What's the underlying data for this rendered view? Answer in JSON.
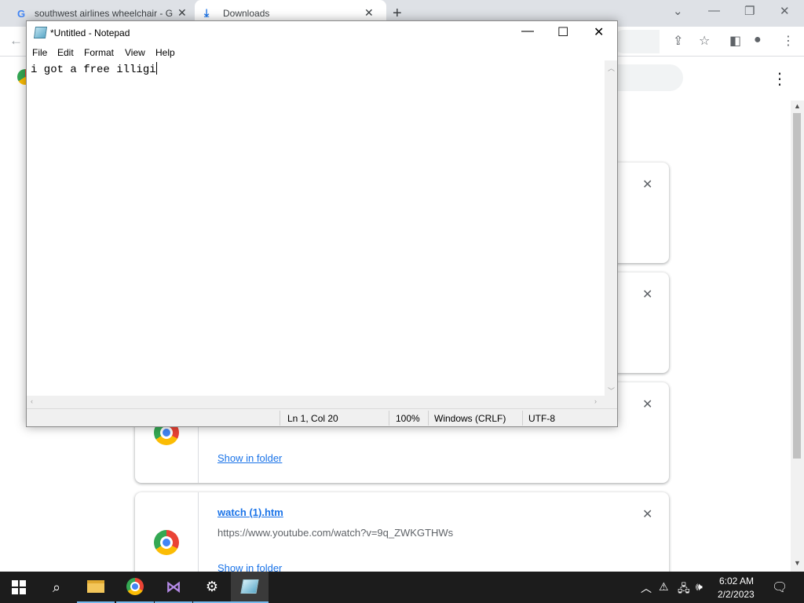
{
  "browser": {
    "tabs": [
      {
        "title": "southwest airlines wheelchair - G",
        "icon": "google-icon"
      },
      {
        "title": "Downloads",
        "icon": "download-icon"
      }
    ],
    "downloads": [
      {
        "action": "Show in folder"
      },
      {
        "filename": "watch (1).htm",
        "url": "https://www.youtube.com/watch?v=9q_ZWKGTHWs",
        "action": "Show in folder"
      }
    ]
  },
  "notepad": {
    "title": "*Untitled - Notepad",
    "menu": [
      "File",
      "Edit",
      "Format",
      "View",
      "Help"
    ],
    "content": "i got a free illigi",
    "status": {
      "position": "Ln 1, Col 20",
      "zoom": "100%",
      "line_ending": "Windows (CRLF)",
      "encoding": "UTF-8"
    }
  },
  "taskbar": {
    "apps": [
      "start",
      "search",
      "file-explorer",
      "chrome",
      "visual-studio",
      "settings",
      "notepad"
    ],
    "clock": {
      "time": "6:02 AM",
      "date": "2/2/2023"
    }
  },
  "colors": {
    "accent": "#1a73e8",
    "taskbar": "#1c1c1c",
    "tab_strip": "#dee1e6"
  }
}
